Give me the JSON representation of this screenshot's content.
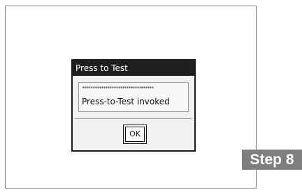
{
  "dialog": {
    "title": "Press to Test",
    "stars": "**********************************",
    "message": "Press-to-Test invoked",
    "ok_label": "OK"
  },
  "step_badge": {
    "label": "Step 8"
  },
  "colors": {
    "title_bar": "#1f1f1f",
    "badge_bg": "#7f7f7f",
    "dialog_bg": "#f1f1f1"
  }
}
